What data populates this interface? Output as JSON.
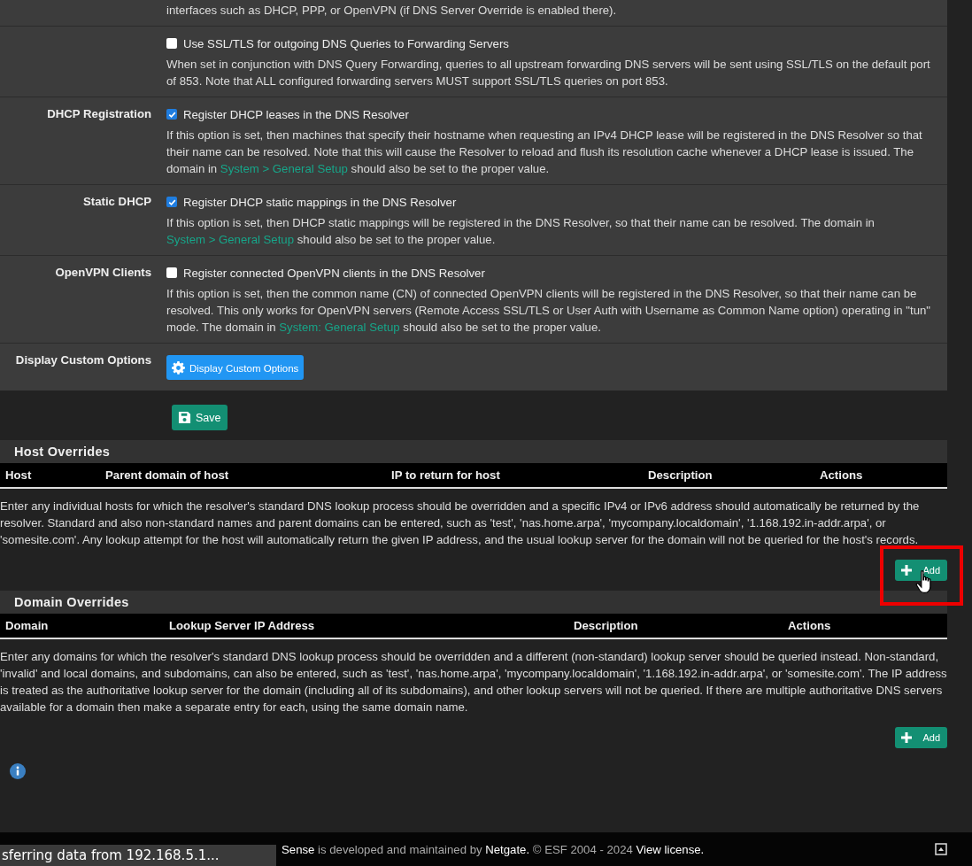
{
  "settings": [
    {
      "help": [
        {
          "kind": "text",
          "text": "interfaces such as DHCP, PPP, or OpenVPN (if DNS Server Override is enabled there)."
        }
      ]
    },
    {
      "checkbox": {
        "label": "Use SSL/TLS for outgoing DNS Queries to Forwarding Servers",
        "checked": false
      },
      "help": [
        {
          "kind": "text",
          "text": "When set in conjunction with DNS Query Forwarding, queries to all upstream forwarding DNS servers will be sent using SSL/TLS on the default port of 853. Note that ALL configured forwarding servers MUST support SSL/TLS queries on port 853."
        }
      ]
    },
    {
      "label": "DHCP Registration",
      "checkbox": {
        "label": "Register DHCP leases in the DNS Resolver",
        "checked": true
      },
      "help": [
        {
          "kind": "text",
          "text": "If this option is set, then machines that specify their hostname when requesting an IPv4 DHCP lease will be registered in the DNS Resolver so that their name can be resolved. Note that this will cause the Resolver to reload and flush its resolution cache whenever a DHCP lease is issued. The domain in "
        },
        {
          "kind": "link",
          "text": "System > General Setup"
        },
        {
          "kind": "text",
          "text": " should also be set to the proper value."
        }
      ]
    },
    {
      "label": "Static DHCP",
      "checkbox": {
        "label": "Register DHCP static mappings in the DNS Resolver",
        "checked": true
      },
      "help": [
        {
          "kind": "text",
          "text": "If this option is set, then DHCP static mappings will be registered in the DNS Resolver, so that their name can be resolved. The domain in "
        },
        {
          "kind": "link",
          "text": "System > General Setup"
        },
        {
          "kind": "text",
          "text": " should also be set to the proper value."
        }
      ]
    },
    {
      "label": "OpenVPN Clients",
      "checkbox": {
        "label": "Register connected OpenVPN clients in the DNS Resolver",
        "checked": false
      },
      "help": [
        {
          "kind": "text",
          "text": "If this option is set, then the common name (CN) of connected OpenVPN clients will be registered in the DNS Resolver, so that their name can be resolved. This only works for OpenVPN servers (Remote Access SSL/TLS or User Auth with Username as Common Name option) operating in \"tun\" mode. The domain in "
        },
        {
          "kind": "link",
          "text": "System: General Setup"
        },
        {
          "kind": "text",
          "text": " should also be set to the proper value."
        }
      ]
    }
  ],
  "custom_options": {
    "label": "Display Custom Options",
    "button": "Display Custom Options"
  },
  "save_button": "Save",
  "sections": [
    {
      "title": "Host Overrides",
      "columns": [
        "Host",
        "Parent domain of host",
        "IP to return for host",
        "Description",
        "Actions"
      ],
      "help": "Enter any individual hosts for which the resolver's standard DNS lookup process should be overridden and a specific IPv4 or IPv6 address should automatically be returned by the resolver. Standard and also non-standard names and parent domains can be entered, such as 'test', 'nas.home.arpa', 'mycompany.localdomain', '1.168.192.in-addr.arpa', or 'somesite.com'. Any lookup attempt for the host will automatically return the given IP address, and the usual lookup server for the domain will not be queried for the host's records.",
      "add_button": "Add",
      "highlighted": true
    },
    {
      "title": "Domain Overrides",
      "columns": [
        "Domain",
        "Lookup Server IP Address",
        "Description",
        "Actions"
      ],
      "help": "Enter any domains for which the resolver's standard DNS lookup process should be overridden and a different (non-standard) lookup server should be queried instead. Non-standard, 'invalid' and local domains, and subdomains, can also be entered, such as 'test', 'nas.home.arpa', 'mycompany.localdomain', '1.168.192.in-addr.arpa', or 'somesite.com'. The IP address is treated as the authoritative lookup server for the domain (including all of its subdomains), and other lookup servers will not be queried. If there are multiple authoritative DNS servers available for a domain then make a separate entry for each, using the same domain name.",
      "add_button": "Add"
    }
  ],
  "footer": [
    {
      "kind": "bright",
      "text": "Sense"
    },
    {
      "kind": "dim",
      "text": " is developed and maintained by "
    },
    {
      "kind": "bright",
      "text": "Netgate."
    },
    {
      "kind": "dim",
      "text": " © ESF 2004 - 2024 "
    },
    {
      "kind": "bright",
      "text": "View license."
    }
  ],
  "status_tooltip": "sferring data from 192.168.5.1..."
}
